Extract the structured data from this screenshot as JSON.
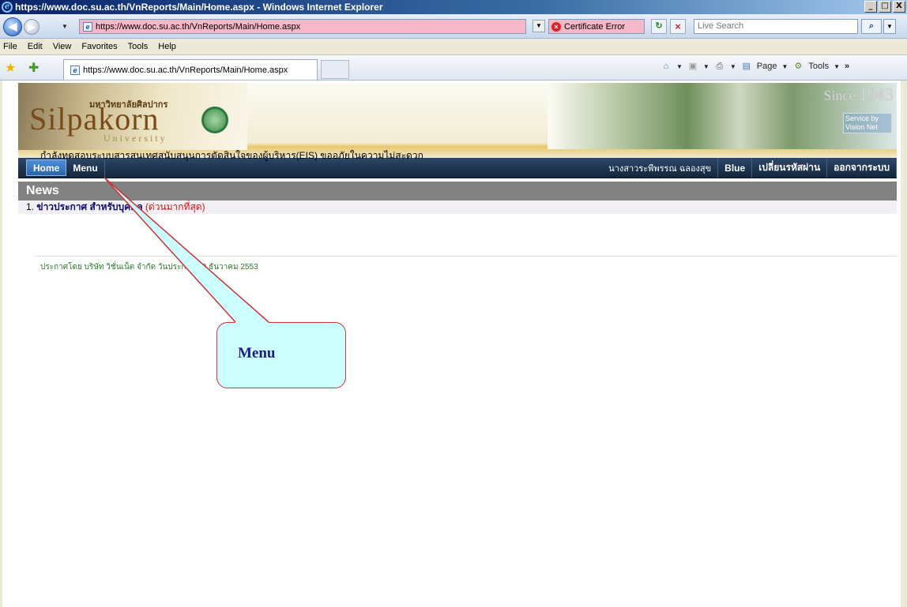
{
  "window": {
    "title": "https://www.doc.su.ac.th/VnReports/Main/Home.aspx - Windows Internet Explorer",
    "controls": [
      "_",
      "□",
      "X"
    ]
  },
  "address": {
    "url": "https://www.doc.su.ac.th/VnReports/Main/Home.aspx",
    "cert_error": "Certificate Error",
    "search_placeholder": "Live Search"
  },
  "menubar": [
    "File",
    "Edit",
    "View",
    "Favorites",
    "Tools",
    "Help"
  ],
  "tab": {
    "label": "https://www.doc.su.ac.th/VnReports/Main/Home.aspx"
  },
  "commandbar": {
    "page": "Page",
    "tools": "Tools"
  },
  "banner": {
    "thai_name": "มหาวิทยาลัยศิลปากร",
    "name": "Silpakorn",
    "sub": "University",
    "since": "Since",
    "year": "1943",
    "partner": "Service by Vision Net"
  },
  "nav": {
    "home": "Home",
    "menu": "Menu",
    "user": "นางสาวระพีพรรณ ฉลองสุข",
    "theme": "Blue",
    "change_password": "เปลี่ยนรหัสผ่าน",
    "logout": "ออกจากระบบ"
  },
  "news": {
    "heading": "News",
    "items": [
      {
        "number": "1.",
        "title": "ข่าวประกาศ สำหรับบุคคล",
        "urgency": "(ด่วนมากที่สุด)",
        "body": "กำลังทดสอบระบบสารสนเทศสนับสนุนการตัดสินใจของผู้บริหาร(EIS) ขออภัยในความไม่สะดวก",
        "footer": "ประกาศโดย บริษัท วิชั่นเน็ต จำกัด วันประกาศ 29 ธันวาคม 2553"
      }
    ]
  },
  "callout": {
    "text": "Menu"
  }
}
